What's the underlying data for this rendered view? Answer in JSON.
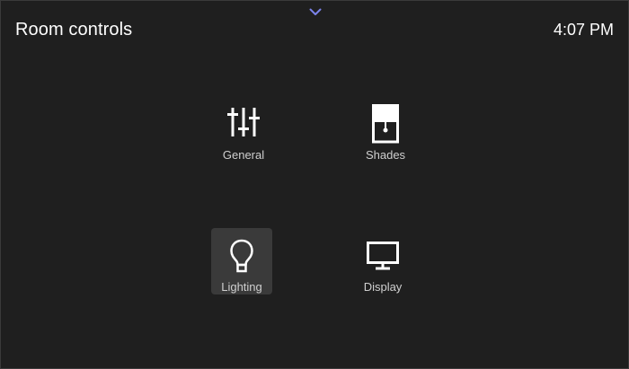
{
  "header": {
    "title": "Room controls",
    "time": "4:07 PM",
    "collapse_icon": "chevron-down-icon"
  },
  "tiles": [
    {
      "label": "General",
      "icon": "sliders-icon",
      "selected": false
    },
    {
      "label": "Shades",
      "icon": "shades-icon",
      "selected": false
    },
    {
      "label": "Lighting",
      "icon": "lightbulb-icon",
      "selected": true
    },
    {
      "label": "Display",
      "icon": "monitor-icon",
      "selected": false
    }
  ],
  "colors": {
    "background": "#1f1f1f",
    "selected_tile": "#3a3a3a",
    "chevron": "#7b83eb",
    "text": "#ffffff",
    "label": "#cfcfcf"
  }
}
